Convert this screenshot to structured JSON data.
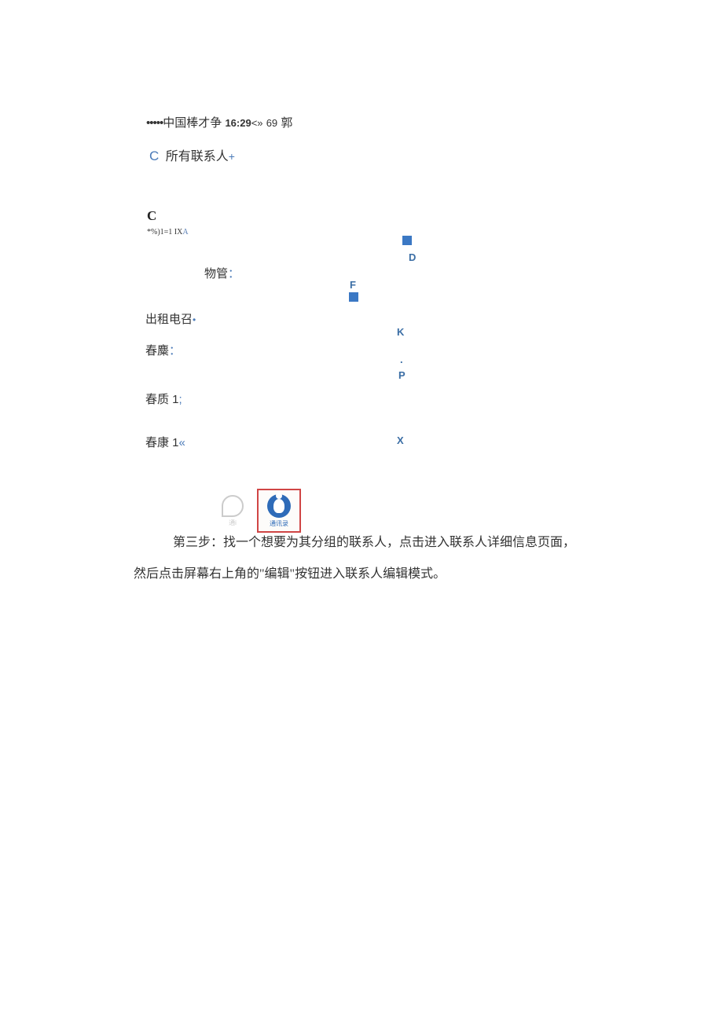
{
  "status": {
    "dots": "•••••",
    "carrier": "中国棒才争",
    "time": "16:29",
    "arrows": "<»",
    "battery": "69",
    "name": "郭"
  },
  "header": {
    "back": "C",
    "title": "所有联系人",
    "plus": "+"
  },
  "section": {
    "letter": "C",
    "subscript": "*%)1=1 IX",
    "subscript_a": "A"
  },
  "contacts": {
    "item1": "物管",
    "item1_suffix": "：",
    "item2": "出租电召",
    "item2_suffix": "•",
    "item3": "春麋",
    "item3_suffix": "：",
    "item4": "春质 1",
    "item4_suffix": ";",
    "item5": "春康 1",
    "item5_suffix": "«"
  },
  "index": {
    "d": "D",
    "f": "F",
    "k": "K",
    "dot": ".",
    "p": "P",
    "x": "X"
  },
  "icons": {
    "clock_label": "通i",
    "contacts_label": "通讯录"
  },
  "step": {
    "text": "第三步：找一个想要为其分组的联系人，点击进入联系人详细信息页面，然后点击屏幕右上角的\"编辑\"按钮进入联系人编辑模式。"
  }
}
